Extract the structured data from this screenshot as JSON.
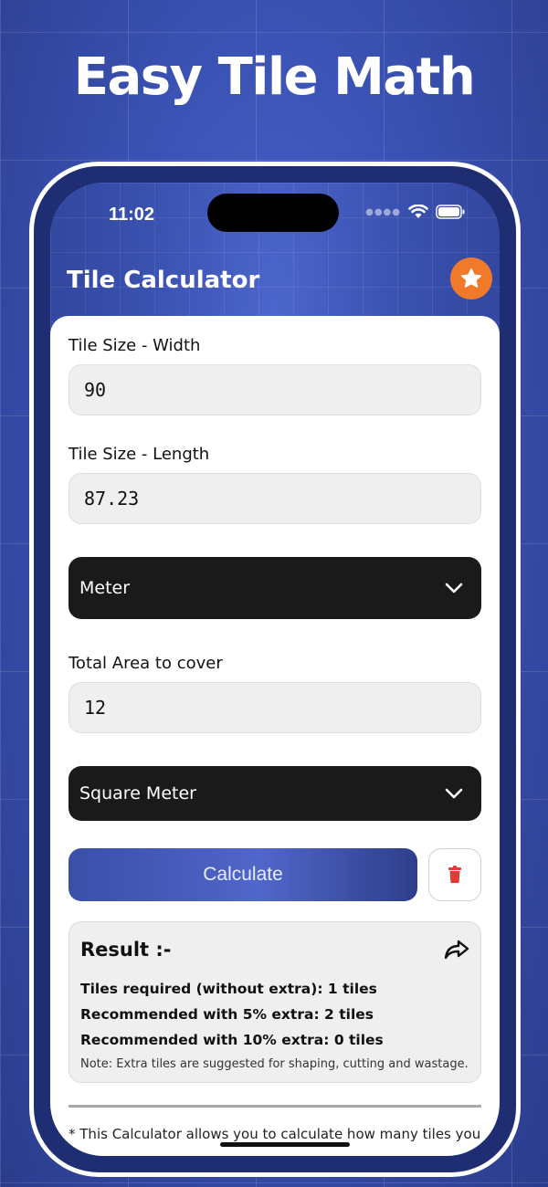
{
  "headline": "Easy Tile Math",
  "status": {
    "time": "11:02"
  },
  "app": {
    "title": "Tile Calculator",
    "star_icon": "star-icon"
  },
  "form": {
    "width_label": "Tile Size - Width",
    "width_value": "90",
    "length_label": "Tile Size - Length",
    "length_value": "87.23",
    "size_unit": "Meter",
    "area_label": "Total Area to cover",
    "area_value": "12",
    "area_unit": "Square Meter"
  },
  "actions": {
    "calculate_label": "Calculate",
    "delete_icon": "trash-icon"
  },
  "result": {
    "title": "Result :-",
    "line1": "Tiles required (without extra): 1 tiles",
    "line2": "Recommended with 5% extra: 2 tiles",
    "line3": "Recommended with 10% extra: 0 tiles",
    "note": "Note: Extra tiles are suggested for shaping, cutting and wastage."
  },
  "footer": {
    "text": "* This Calculator allows you to calculate how many tiles you"
  },
  "colors": {
    "accent_blue": "#3a51b0",
    "star_orange": "#f07a2a",
    "delete_red": "#e53935",
    "dropdown_bg": "#1a1a1a"
  }
}
